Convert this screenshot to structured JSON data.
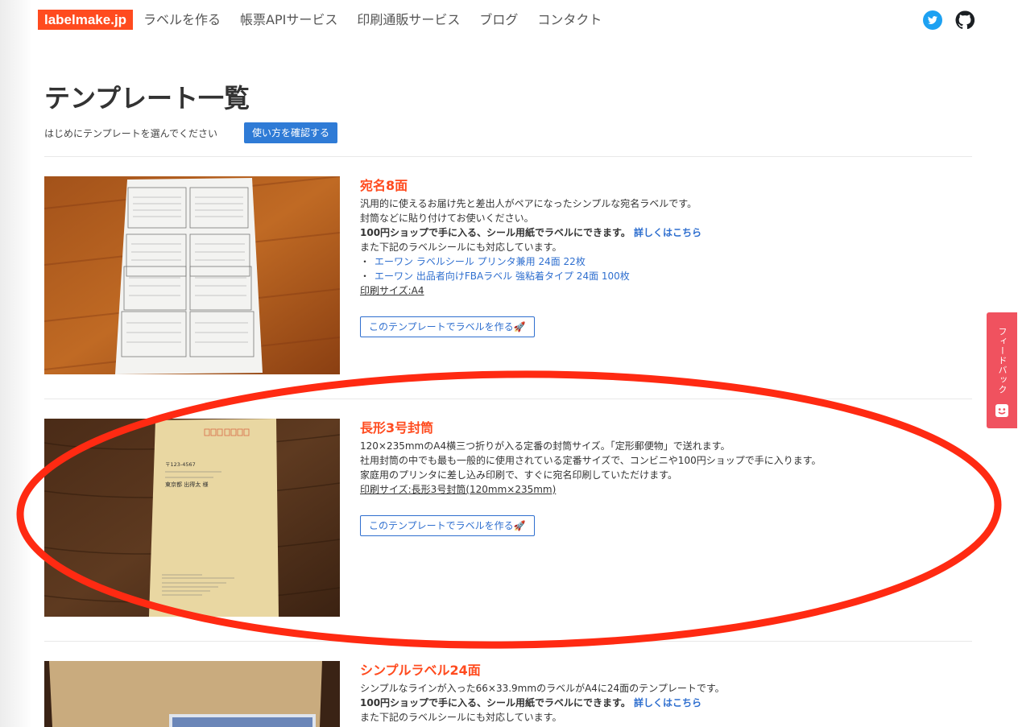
{
  "navbar": {
    "brand": "labelmake.jp",
    "links": [
      "ラベルを作る",
      "帳票APIサービス",
      "印刷通販サービス",
      "ブログ",
      "コンタクト"
    ],
    "social_icons": [
      "twitter-icon",
      "github-icon"
    ]
  },
  "page": {
    "title": "テンプレート一覧",
    "intro": "はじめにテンプレートを選んでください",
    "howto_button": "使い方を確認する"
  },
  "templates": [
    {
      "title": "宛名8面",
      "lines": [
        "汎用的に使えるお届け先と差出人がペアになったシンプルな宛名ラベルです。",
        "封筒などに貼り付けてお使いください。"
      ],
      "bold_line": "100円ショップで手に入る、シール用紙でラベルにできます。",
      "detail_link": "詳しくはこちら",
      "compat_line": "また下記のラベルシールにも対応しています。",
      "compat_items": [
        "エーワン ラベルシール プリンタ兼用 24面 22枚",
        "エーワン 出品者向けFBAラベル 強粘着タイプ 24面 100枚"
      ],
      "print_size": "印刷サイズ:A4",
      "button": "このテンプレートでラベルを作る🚀"
    },
    {
      "title": "長形3号封筒",
      "lines": [
        "120×235mmのA4横三つ折りが入る定番の封筒サイズ。「定形郵便物」で送れます。",
        "社用封筒の中でも最も一般的に使用されている定番サイズで、コンビニや100円ショップで手に入ります。",
        "家庭用のプリンタに差し込み印刷で、すぐに宛名印刷していただけます。"
      ],
      "print_size": "印刷サイズ:長形3号封筒(120mm×235mm)",
      "button": "このテンプレートでラベルを作る🚀",
      "envelope": {
        "postal": "〒123-4567",
        "recipient": "東京都 出得太 様"
      }
    },
    {
      "title": "シンプルラベル24面",
      "lines": [
        "シンプルなラインが入った66×33.9mmのラベルがA4に24面のテンプレートです。"
      ],
      "bold_line": "100円ショップで手に入る、シール用紙でラベルにできます。",
      "detail_link": "詳しくはこちら",
      "compat_line": "また下記のラベルシールにも対応しています。"
    }
  ],
  "feedback": {
    "label": "フィードバック"
  },
  "colors": {
    "brand": "#ff4b1f",
    "link": "#2f6fcf",
    "primary_button": "#2f7bd6",
    "feedback": "#f0525f",
    "annotation": "#ff2a12"
  }
}
